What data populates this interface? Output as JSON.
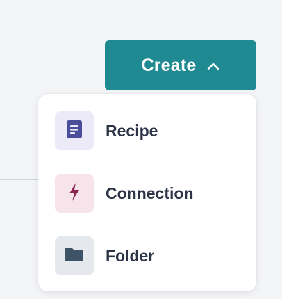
{
  "create_button": {
    "label": "Create",
    "icon": "chevron-up-icon",
    "color": "#1f8a92"
  },
  "menu": {
    "items": [
      {
        "label": "Recipe",
        "icon": "recipe-icon",
        "icon_color": "#4b4e9b",
        "tile_color": "#eceaf9"
      },
      {
        "label": "Connection",
        "icon": "lightning-icon",
        "icon_color": "#8b2650",
        "tile_color": "#f7e3ea"
      },
      {
        "label": "Folder",
        "icon": "folder-icon",
        "icon_color": "#3e5466",
        "tile_color": "#e5e9ed"
      }
    ]
  }
}
